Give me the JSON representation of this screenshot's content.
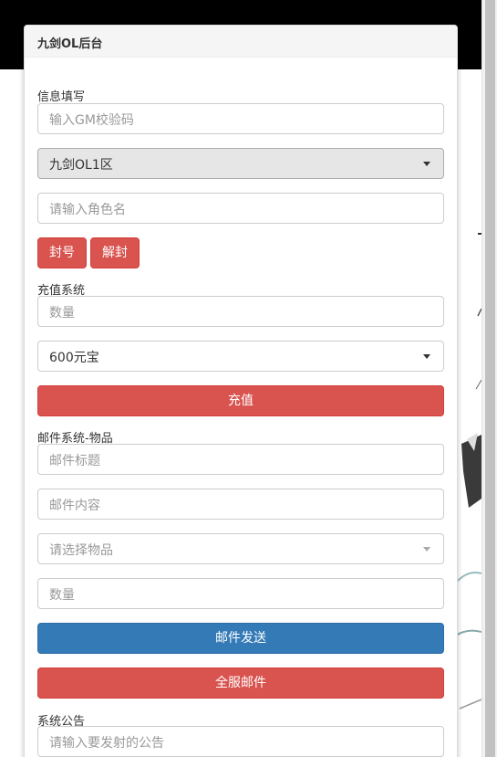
{
  "panel": {
    "title": "九剑OL后台"
  },
  "info": {
    "label": "信息填写",
    "gm_code_placeholder": "输入GM校验码",
    "server_selected": "九剑OL1区",
    "role_placeholder": "请输入角色名",
    "ban_label": "封号",
    "unban_label": "解封"
  },
  "recharge": {
    "label": "充值系统",
    "quantity_placeholder": "数量",
    "amount_selected": "600元宝",
    "submit_label": "充值"
  },
  "mail": {
    "label": "邮件系统-物品",
    "title_placeholder": "邮件标题",
    "content_placeholder": "邮件内容",
    "item_placeholder": "请选择物品",
    "quantity_placeholder": "数量",
    "send_label": "邮件发送",
    "broadcast_label": "全服邮件"
  },
  "notice": {
    "label": "系统公告",
    "input_placeholder": "请输入要发射的公告"
  },
  "colors": {
    "danger": "#d9534f",
    "primary": "#337ab7",
    "header_band": "#000000"
  }
}
